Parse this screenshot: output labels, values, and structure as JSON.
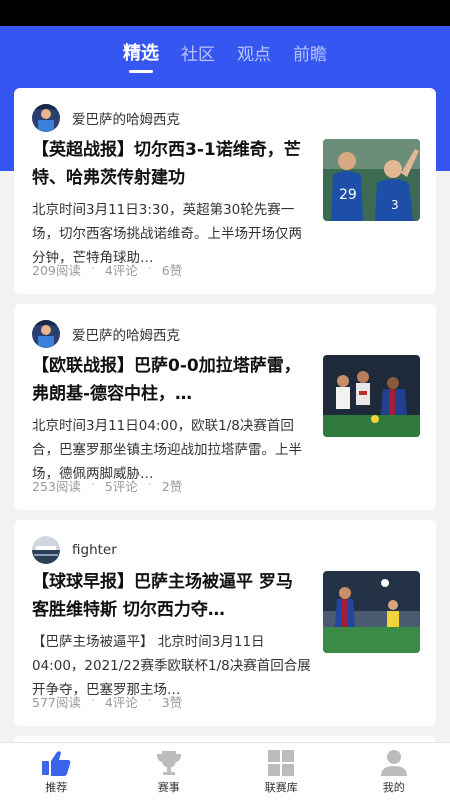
{
  "tabs": [
    {
      "label": "精选"
    },
    {
      "label": "社区"
    },
    {
      "label": "观点"
    },
    {
      "label": "前瞻"
    }
  ],
  "posts": [
    {
      "author": "爱巴萨的哈姆西克",
      "title": "【英超战报】切尔西3-1诺维奇，芒特、哈弗茨传射建功",
      "excerpt": "北京时间3月11日3:30，英超第30轮先赛一场，切尔西客场挑战诺维奇。上半场开场仅两分钟，芒特角球助…",
      "reads": "209阅读",
      "comments": "4评论",
      "likes": "6赞",
      "thumb": "chelsea-celebration-photo"
    },
    {
      "author": "爱巴萨的哈姆西克",
      "title": "【欧联战报】巴萨0-0加拉塔萨雷，弗朗基-德容中柱，…",
      "excerpt": "北京时间3月11日04:00，欧联1/8决赛首回合，巴塞罗那坐镇主场迎战加拉塔萨雷。上半场，德佩两脚威胁…",
      "reads": "253阅读",
      "comments": "5评论",
      "likes": "2赞",
      "thumb": "barca-galatasaray-photo"
    },
    {
      "author": "fighter",
      "title": "【球球早报】巴萨主场被逼平 罗马客胜维特斯 切尔西力夺…",
      "excerpt": "【巴萨主场被逼平】 北京时间3月11日04:00，2021/22赛季欧联杯1/8决赛首回合展开争夺，巴塞罗那主场…",
      "reads": "577阅读",
      "comments": "4评论",
      "likes": "3赞",
      "thumb": "barca-match-photo"
    }
  ],
  "nav": [
    {
      "label": "推荐",
      "icon": "thumbs-up-icon"
    },
    {
      "label": "赛事",
      "icon": "trophy-icon"
    },
    {
      "label": "联赛库",
      "icon": "grid-icon"
    },
    {
      "label": "我的",
      "icon": "user-icon"
    }
  ],
  "colors": {
    "brand": "#3556f0",
    "active_nav": "#3a64ec"
  }
}
